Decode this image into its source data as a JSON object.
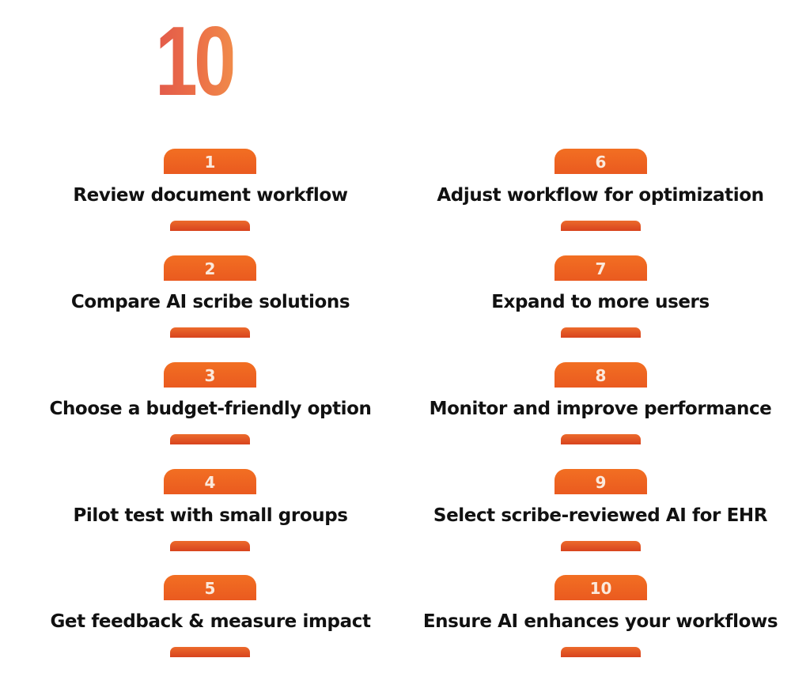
{
  "header": {
    "big_number": "10"
  },
  "colors": {
    "badge_top": "#f26f22",
    "badge_bottom": "#ea5a20",
    "bar_bottom": "#d8431e",
    "title_text": "#111111",
    "number_gradient_start": "#e25a4a",
    "number_gradient_end": "#f08a4a"
  },
  "steps": [
    {
      "number": "1",
      "title": "Review document workflow"
    },
    {
      "number": "2",
      "title": "Compare AI scribe solutions"
    },
    {
      "number": "3",
      "title": "Choose a budget-friendly option"
    },
    {
      "number": "4",
      "title": "Pilot test with small groups"
    },
    {
      "number": "5",
      "title": "Get feedback & measure impact"
    },
    {
      "number": "6",
      "title": "Adjust workflow for optimization"
    },
    {
      "number": "7",
      "title": "Expand to more users"
    },
    {
      "number": "8",
      "title": "Monitor and improve performance"
    },
    {
      "number": "9",
      "title": "Select scribe-reviewed AI for EHR"
    },
    {
      "number": "10",
      "title": "Ensure AI enhances your workflows"
    }
  ]
}
